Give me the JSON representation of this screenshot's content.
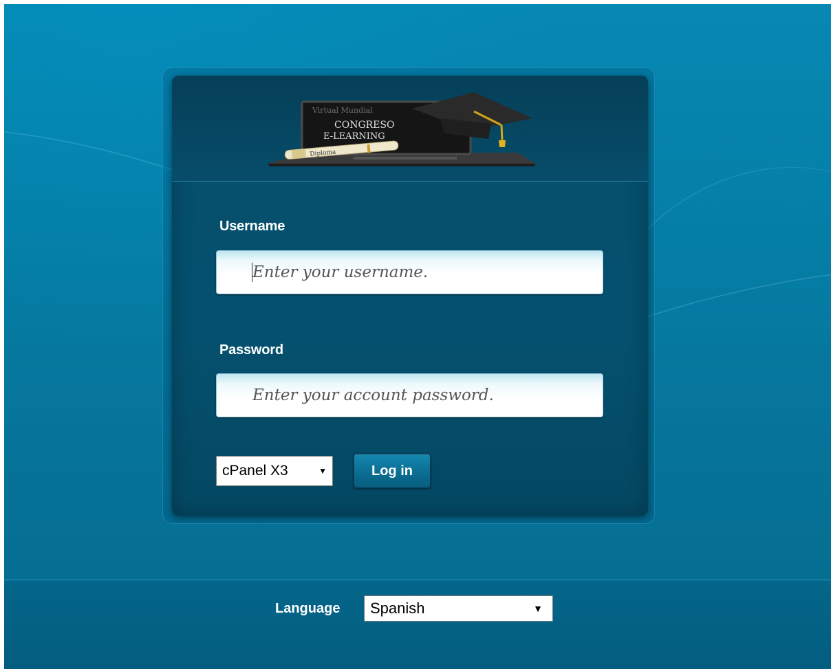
{
  "logo": {
    "tagline": "Virtual Mundial",
    "title_line1": "CONGRESO",
    "title_line2": "E-LEARNING",
    "diploma_text": "Diploma"
  },
  "login": {
    "username_label": "Username",
    "username_placeholder": "Enter your username.",
    "username_value": "",
    "password_label": "Password",
    "password_placeholder": "Enter your account password.",
    "password_value": "",
    "theme_select": {
      "selected": "cPanel X3",
      "arrow": "▼"
    },
    "login_button": "Log in"
  },
  "footer": {
    "language_label": "Language",
    "language_select": {
      "selected": "Spanish",
      "arrow": "▼"
    }
  },
  "colors": {
    "background": "#057ea6",
    "panel": "#05506e",
    "button": "#0b6e93"
  }
}
